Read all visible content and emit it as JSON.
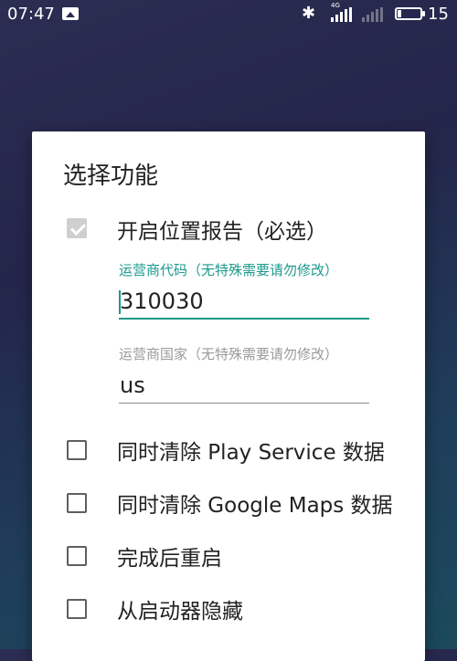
{
  "status_bar": {
    "time": "07:47",
    "signal1_label": "4G",
    "battery_level": "15",
    "battery_fraction": 0.15
  },
  "dialog": {
    "title": "选择功能",
    "location_report": {
      "label": "开启位置报告（必选）",
      "checked": true,
      "disabled": true
    },
    "carrier_code": {
      "label": "运营商代码（无特殊需要请勿修改）",
      "value": "310030"
    },
    "carrier_country": {
      "label": "运营商国家（无特殊需要请勿修改）",
      "value": "us"
    },
    "options": [
      {
        "label": "同时清除 Play Service 数据",
        "checked": false
      },
      {
        "label": "同时清除 Google Maps 数据",
        "checked": false
      },
      {
        "label": "完成后重启",
        "checked": false
      },
      {
        "label": "从启动器隐藏",
        "checked": false
      }
    ]
  },
  "colors": {
    "accent": "#1b9a8c",
    "disabled_check": "#cfcfcf"
  }
}
